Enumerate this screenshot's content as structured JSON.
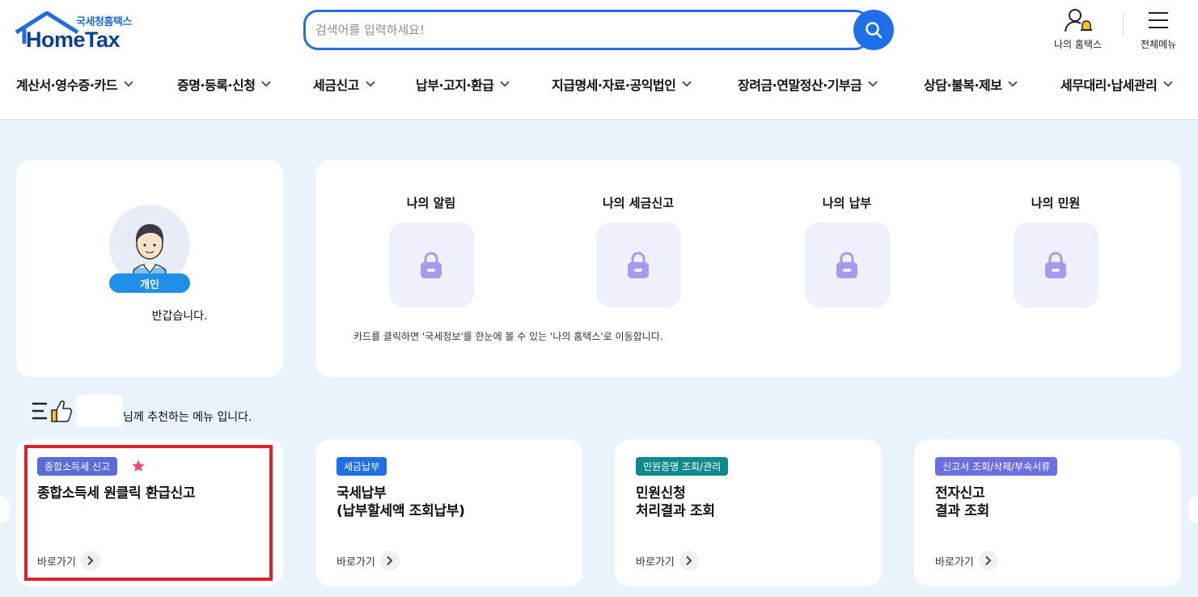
{
  "header": {
    "logo_sub": "국세청홈택스",
    "logo_main": "HomeTax",
    "search_placeholder": "검색어를 입력하세요!",
    "my_hometax_label": "나의 홈택스",
    "all_menu_label": "전체메뉴"
  },
  "gnb": [
    {
      "label": "계산서·영수증·카드"
    },
    {
      "label": "증명·등록·신청"
    },
    {
      "label": "세금신고"
    },
    {
      "label": "납부·고지·환급"
    },
    {
      "label": "지급명세·자료·공익법인"
    },
    {
      "label": "장려금·연말정산·기부금"
    },
    {
      "label": "상담·불복·제보"
    },
    {
      "label": "세무대리·납세관리"
    }
  ],
  "profile": {
    "type_label": "개인",
    "greeting": "반갑습니다."
  },
  "my_section": {
    "items": [
      {
        "label": "나의 알림",
        "icon": "lock-icon"
      },
      {
        "label": "나의 세금신고",
        "icon": "lock-icon"
      },
      {
        "label": "나의 납부",
        "icon": "lock-icon"
      },
      {
        "label": "나의 민원",
        "icon": "lock-icon"
      }
    ],
    "note": "카드를 클릭하면 '국세정보'를 한눈에 볼 수 있는 '나의 홈택스'로 이동합니다."
  },
  "recommend": {
    "text": "님께 추천하는 메뉴 입니다."
  },
  "menu_cards": [
    {
      "tag": "종합소득세 신고",
      "tag_color": "#5b6bd8",
      "title": "종합소득세 원클릭 환급신고",
      "link": "바로가기",
      "favorite": true
    },
    {
      "tag": "세금납부",
      "tag_color": "#1f6fe8",
      "title": "국세납부\n(납부할세액 조회납부)",
      "link": "바로가기",
      "favorite": false
    },
    {
      "tag": "민원증명 조회/관리",
      "tag_color": "#0e8a8f",
      "title": "민원신청\n처리결과 조회",
      "link": "바로가기",
      "favorite": false
    },
    {
      "tag": "신고서 조회/삭제/부속서류",
      "tag_color": "#6b6fe0",
      "title": "전자신고\n결과 조회",
      "link": "바로가기",
      "favorite": false
    }
  ],
  "colors": {
    "accent": "#1f6fe8",
    "highlight": "#e0202a",
    "background": "#e9f3fb"
  }
}
